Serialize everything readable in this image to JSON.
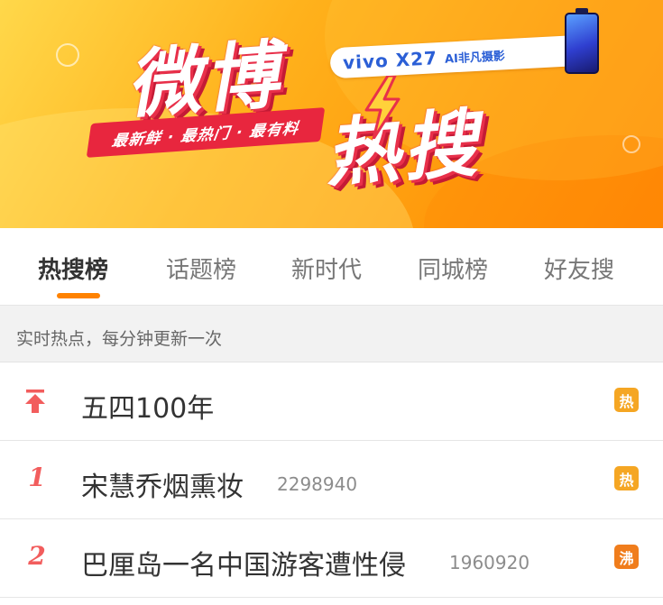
{
  "banner": {
    "logo_line1": "微博",
    "logo_line2": "热搜",
    "slogan": "最新鲜 · 最热门 · 最有料",
    "sponsor_brand": "vivo X27",
    "sponsor_tag": "AI非凡摄影",
    "colors": {
      "background": "#ffb21c",
      "logo_shadow": "#e8304a",
      "slogan_bg": "#e8263e",
      "sponsor_text": "#2b5fd6"
    }
  },
  "tabs": [
    {
      "label": "热搜榜",
      "active": true
    },
    {
      "label": "话题榜",
      "active": false
    },
    {
      "label": "新时代",
      "active": false
    },
    {
      "label": "同城榜",
      "active": false
    },
    {
      "label": "好友搜",
      "active": false
    }
  ],
  "accent_color": "#ff8200",
  "notice": "实时热点，每分钟更新一次",
  "hot_list": [
    {
      "rank": "",
      "icon": "pin-top-icon",
      "title": "五四100年",
      "count": "",
      "badge": "热",
      "badge_color": "#f5a623"
    },
    {
      "rank": "1",
      "icon": "",
      "title": "宋慧乔烟熏妆",
      "count": "2298940",
      "badge": "热",
      "badge_color": "#f5a623"
    },
    {
      "rank": "2",
      "icon": "",
      "title": "巴厘岛一名中国游客遭性侵",
      "count": "1960920",
      "badge": "沸",
      "badge_color": "#f07d1c"
    }
  ]
}
